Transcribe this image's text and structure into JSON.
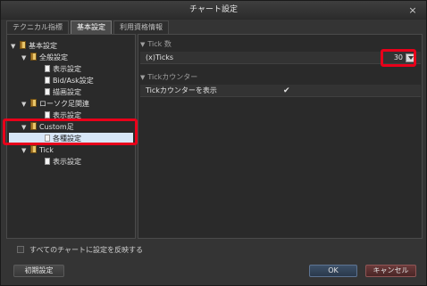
{
  "window": {
    "title": "チャート設定",
    "close_glyph": "×"
  },
  "tabs": [
    {
      "label": "テクニカル指標",
      "active": false
    },
    {
      "label": "基本設定",
      "active": true
    },
    {
      "label": "利用資格情報",
      "active": false
    }
  ],
  "tree": {
    "expand_arrow": "▼",
    "items": [
      {
        "label": "基本設定",
        "icon": "book-icon"
      },
      {
        "label": "全般設定",
        "icon": "book-icon"
      },
      {
        "label": "表示設定",
        "icon": "page-icon"
      },
      {
        "label": "Bid/Ask設定",
        "icon": "page-icon"
      },
      {
        "label": "描画設定",
        "icon": "page-icon"
      },
      {
        "label": "ローソク足関連",
        "icon": "book-icon"
      },
      {
        "label": "表示設定",
        "icon": "page-icon"
      },
      {
        "label": "Custom足",
        "icon": "book-icon"
      },
      {
        "label": "各種設定",
        "icon": "page-icon",
        "selected": true
      },
      {
        "label": "Tick",
        "icon": "book-icon"
      },
      {
        "label": "表示設定",
        "icon": "page-icon"
      }
    ]
  },
  "settings": {
    "section_arrow": "▼",
    "tick_section": {
      "header": "Tick 数",
      "rows": [
        {
          "label": "(x)Ticks",
          "value": "30"
        }
      ]
    },
    "counter_section": {
      "header": "Tickカウンター",
      "rows": [
        {
          "label": "Tickカウンターを表示",
          "checked": true,
          "check_glyph": "✔"
        }
      ]
    }
  },
  "footer": {
    "apply_all_label": "すべてのチャートに設定を反映する",
    "apply_all_checked": false,
    "reset_label": "初期設定",
    "ok_label": "OK",
    "cancel_label": "キャンセル"
  },
  "colors": {
    "highlight": "#e8001a",
    "selected_row": "#d7e6f7",
    "ok_button": "#3d5068",
    "cancel_button": "#6a3a3a"
  }
}
